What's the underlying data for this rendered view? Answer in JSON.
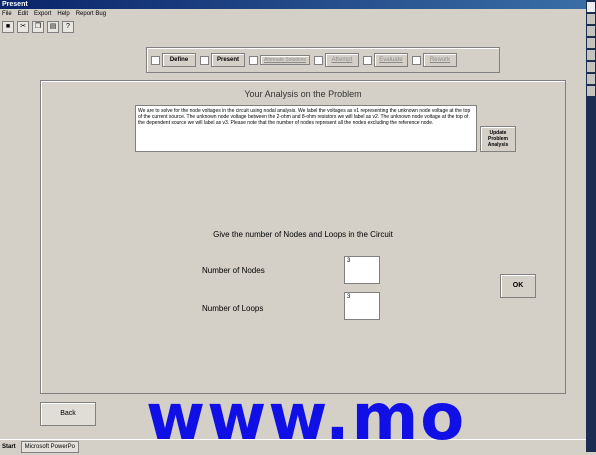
{
  "window": {
    "title": "Present"
  },
  "menu": [
    "File",
    "Edit",
    "Export",
    "Help",
    "Report Bug"
  ],
  "tabs": [
    {
      "label": "Define",
      "enabled": true
    },
    {
      "label": "Present",
      "enabled": true
    },
    {
      "label": "Alternate Solutions",
      "enabled": false
    },
    {
      "label": "Attempt",
      "enabled": false
    },
    {
      "label": "Evaluate",
      "enabled": false
    },
    {
      "label": "Rework",
      "enabled": false
    }
  ],
  "panel": {
    "title": "Your Analysis on the Problem",
    "analysis_text": "We are to solve for the node voltages in the circuit using nodal analysis. We label the voltages as v1 representing the unknown node voltage at the top of the current source. The unknown node voltage between the 2-ohm and 8-ohm resistors we will label as v2. The unknown node voltage at the top of the dependent source we will label as v3. Please note that the number of nodes represent all the nodes excluding the reference node.",
    "update_button": "Update Problem Analysis",
    "question": "Give the number of Nodes and Loops in the Circuit",
    "nodes_label": "Number of Nodes",
    "nodes_value": "3",
    "loops_label": "Number of Loops",
    "loops_value": "3",
    "ok_button": "OK"
  },
  "back_button": "Back",
  "taskbar": {
    "start": "Start",
    "task1": "Microsoft PowerPo"
  },
  "watermark": "www.mo"
}
